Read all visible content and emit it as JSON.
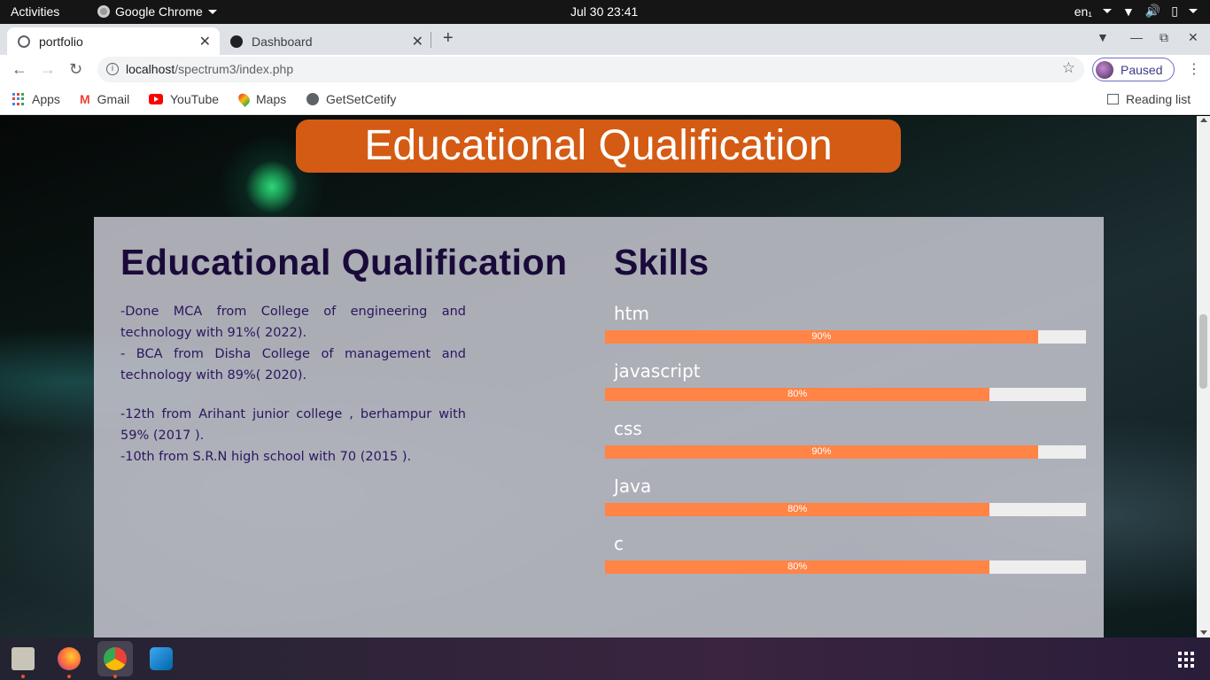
{
  "topbar": {
    "activities": "Activities",
    "app_name": "Google Chrome",
    "clock": "Jul 30  23:41",
    "lang": "en₁"
  },
  "tabs": [
    {
      "label": "portfolio",
      "icon": "globe-icon",
      "active": true
    },
    {
      "label": "Dashboard",
      "icon": "dashboard-icon",
      "active": false
    }
  ],
  "address": {
    "host": "localhost",
    "path": "/spectrum3/index.php"
  },
  "profile": {
    "label": "Paused"
  },
  "bookmarks": [
    {
      "label": "Apps"
    },
    {
      "label": "Gmail"
    },
    {
      "label": "YouTube"
    },
    {
      "label": "Maps"
    },
    {
      "label": "GetSetCetify"
    }
  ],
  "reading_list": "Reading list",
  "page": {
    "banner": "Educational Qualification",
    "education": {
      "heading": "Educational Qualification",
      "lines": [
        "-Done MCA from College of engineering and technology with 91%( 2022).",
        "- BCA from Disha College of management and technology with 89%( 2020).",
        "-12th from Arihant junior college , berhampur with 59% (2017 ).",
        "-10th from S.R.N high school with 70 (2015 )."
      ]
    },
    "skills": {
      "heading": "Skills",
      "items": [
        {
          "name": "htm",
          "percent": 90,
          "label": "90%"
        },
        {
          "name": "javascript",
          "percent": 80,
          "label": "80%"
        },
        {
          "name": "css",
          "percent": 90,
          "label": "90%"
        },
        {
          "name": "Java",
          "percent": 80,
          "label": "80%"
        },
        {
          "name": "c",
          "percent": 80,
          "label": "80%"
        }
      ]
    }
  },
  "colors": {
    "banner": "#d45b14",
    "skill_bar": "#ff8446",
    "heading": "#1a0a3a"
  }
}
